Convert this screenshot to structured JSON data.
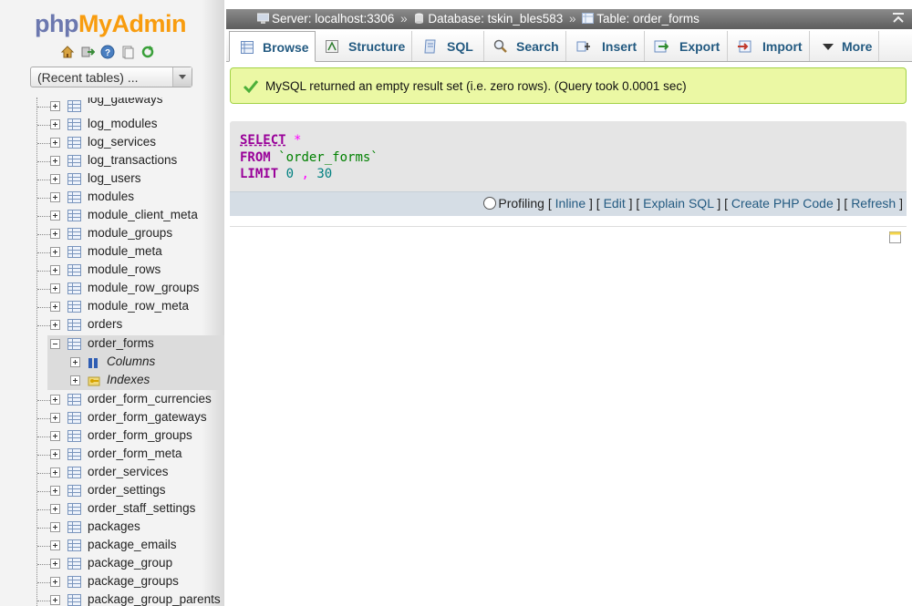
{
  "logo": {
    "part1": "php",
    "part2": "MyAdmin"
  },
  "sidebar": {
    "quick_icons": [
      "home-icon",
      "exit-icon",
      "help-icon",
      "docs-icon",
      "reload-icon"
    ],
    "recent_select": "(Recent tables) ...",
    "tables_before": [
      "log_gateways",
      "log_modules",
      "log_services",
      "log_transactions",
      "log_users",
      "modules",
      "module_client_meta",
      "module_groups",
      "module_meta",
      "module_rows",
      "module_row_groups",
      "module_row_meta",
      "orders"
    ],
    "active_table": "order_forms",
    "active_children": [
      "Columns",
      "Indexes"
    ],
    "tables_after": [
      "order_form_currencies",
      "order_form_gateways",
      "order_form_groups",
      "order_form_meta",
      "order_services",
      "order_settings",
      "order_staff_settings",
      "packages",
      "package_emails",
      "package_group",
      "package_groups",
      "package_group_parents"
    ]
  },
  "breadcrumb": {
    "server": "Server: localhost:3306",
    "database": "Database: tskin_bles583",
    "table": "Table: order_forms",
    "separator": "»"
  },
  "tabs": [
    "Browse",
    "Structure",
    "SQL",
    "Search",
    "Insert",
    "Export",
    "Import",
    "More"
  ],
  "success_message": "MySQL returned an empty result set (i.e. zero rows). (Query took 0.0001 sec)",
  "query": {
    "select": "SELECT",
    "star": "*",
    "from": "FROM",
    "table": "`order_forms`",
    "limit": "LIMIT",
    "offset": "0",
    "comma": ",",
    "count": "30"
  },
  "query_links": {
    "profiling": "Profiling",
    "inline": "Inline",
    "edit": "Edit",
    "explain": "Explain SQL",
    "php": "Create PHP Code",
    "refresh": "Refresh"
  },
  "colors": {
    "accent": "#235a81",
    "success_bg": "#ebf8a4",
    "keyword": "#990099"
  }
}
